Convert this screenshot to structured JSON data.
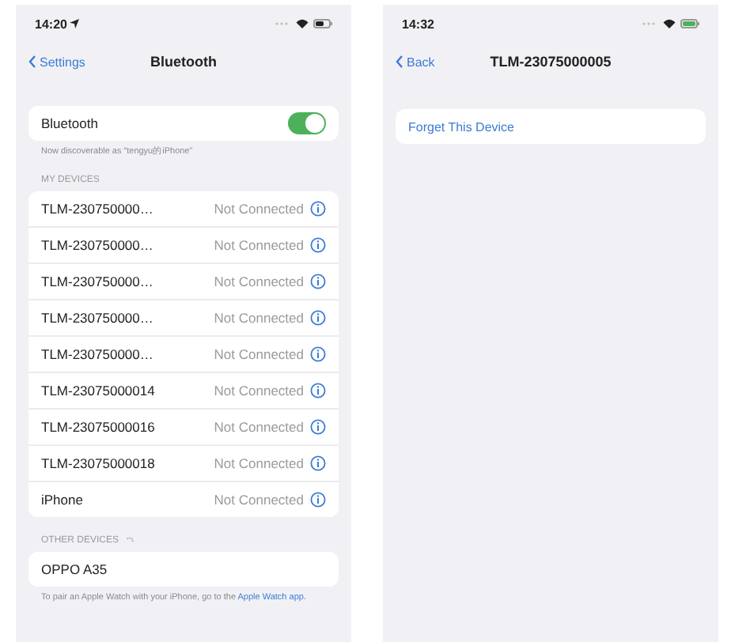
{
  "screens": [
    {
      "status_bar": {
        "time": "14:20",
        "location": true,
        "battery_charging": false
      },
      "nav": {
        "back": "Settings",
        "title": "Bluetooth"
      },
      "bluetooth": {
        "label": "Bluetooth",
        "on": true,
        "caption": "Now discoverable as “tengyu的iPhone”"
      },
      "my_devices": {
        "header": "MY DEVICES",
        "devices": [
          {
            "name": "TLM-230750000…",
            "status": "Not Connected"
          },
          {
            "name": "TLM-230750000…",
            "status": "Not Connected"
          },
          {
            "name": "TLM-230750000…",
            "status": "Not Connected"
          },
          {
            "name": "TLM-230750000…",
            "status": "Not Connected"
          },
          {
            "name": "TLM-230750000…",
            "status": "Not Connected"
          },
          {
            "name": "TLM-23075000014",
            "status": "Not Connected"
          },
          {
            "name": "TLM-23075000016",
            "status": "Not Connected"
          },
          {
            "name": "TLM-23075000018",
            "status": "Not Connected"
          },
          {
            "name": "iPhone",
            "status": "Not Connected"
          }
        ]
      },
      "other_devices": {
        "header": "OTHER DEVICES",
        "searching": true,
        "devices": [
          {
            "name": "OPPO A35"
          }
        ],
        "footer": "To pair an Apple Watch with your iPhone, go to the",
        "footer_link": "Apple Watch app."
      }
    },
    {
      "status_bar": {
        "time": "14:32",
        "location": false,
        "battery_charging": true
      },
      "nav": {
        "back": "Back",
        "title": "TLM-23075000005"
      },
      "actions": [
        "Forget This Device"
      ]
    }
  ]
}
